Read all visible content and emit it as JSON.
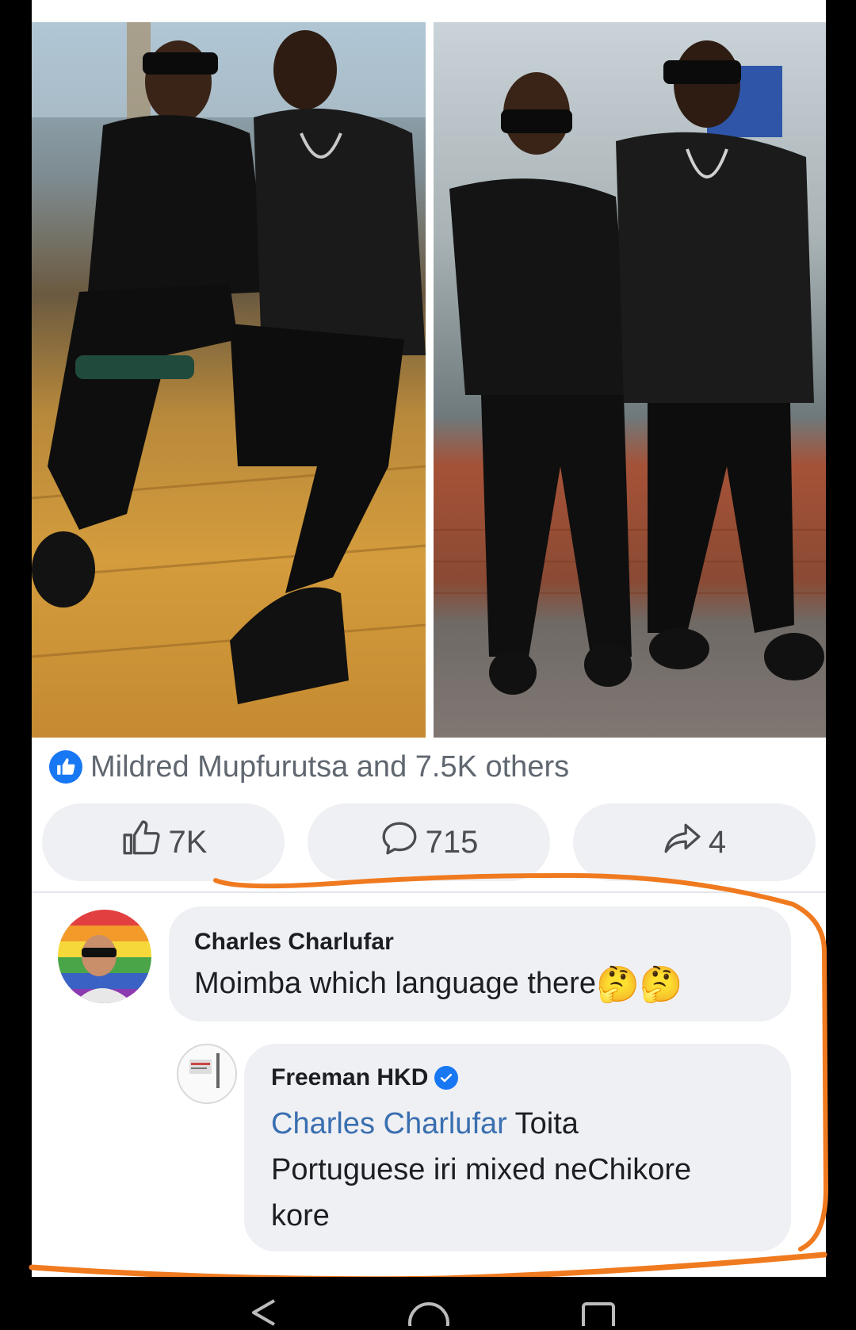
{
  "post": {
    "reactions_summary": "Mildred Mupfurutsa and 7.5K others"
  },
  "actions": {
    "like_count": "7K",
    "comment_count": "715",
    "share_count": "4"
  },
  "comments": [
    {
      "author": "Charles Charlufar",
      "text": "Moimba which language there",
      "emojis": "🤔🤔"
    },
    {
      "author": "Freeman HKD",
      "mention": "Charles Charlufar",
      "text_line1": " Toita",
      "text_line2": "Portuguese iri mixed neChikore",
      "text_line3": "kore"
    }
  ],
  "colors": {
    "facebook_blue": "#1877f2",
    "annotation_orange": "#f07a1f",
    "bubble_gray": "#eff0f3"
  },
  "icons": [
    "like-icon",
    "thumbs-up-outline-icon",
    "comment-bubble-icon",
    "share-arrow-icon",
    "verified-badge-icon",
    "back-triangle-icon",
    "home-circle-icon",
    "recents-square-icon"
  ]
}
